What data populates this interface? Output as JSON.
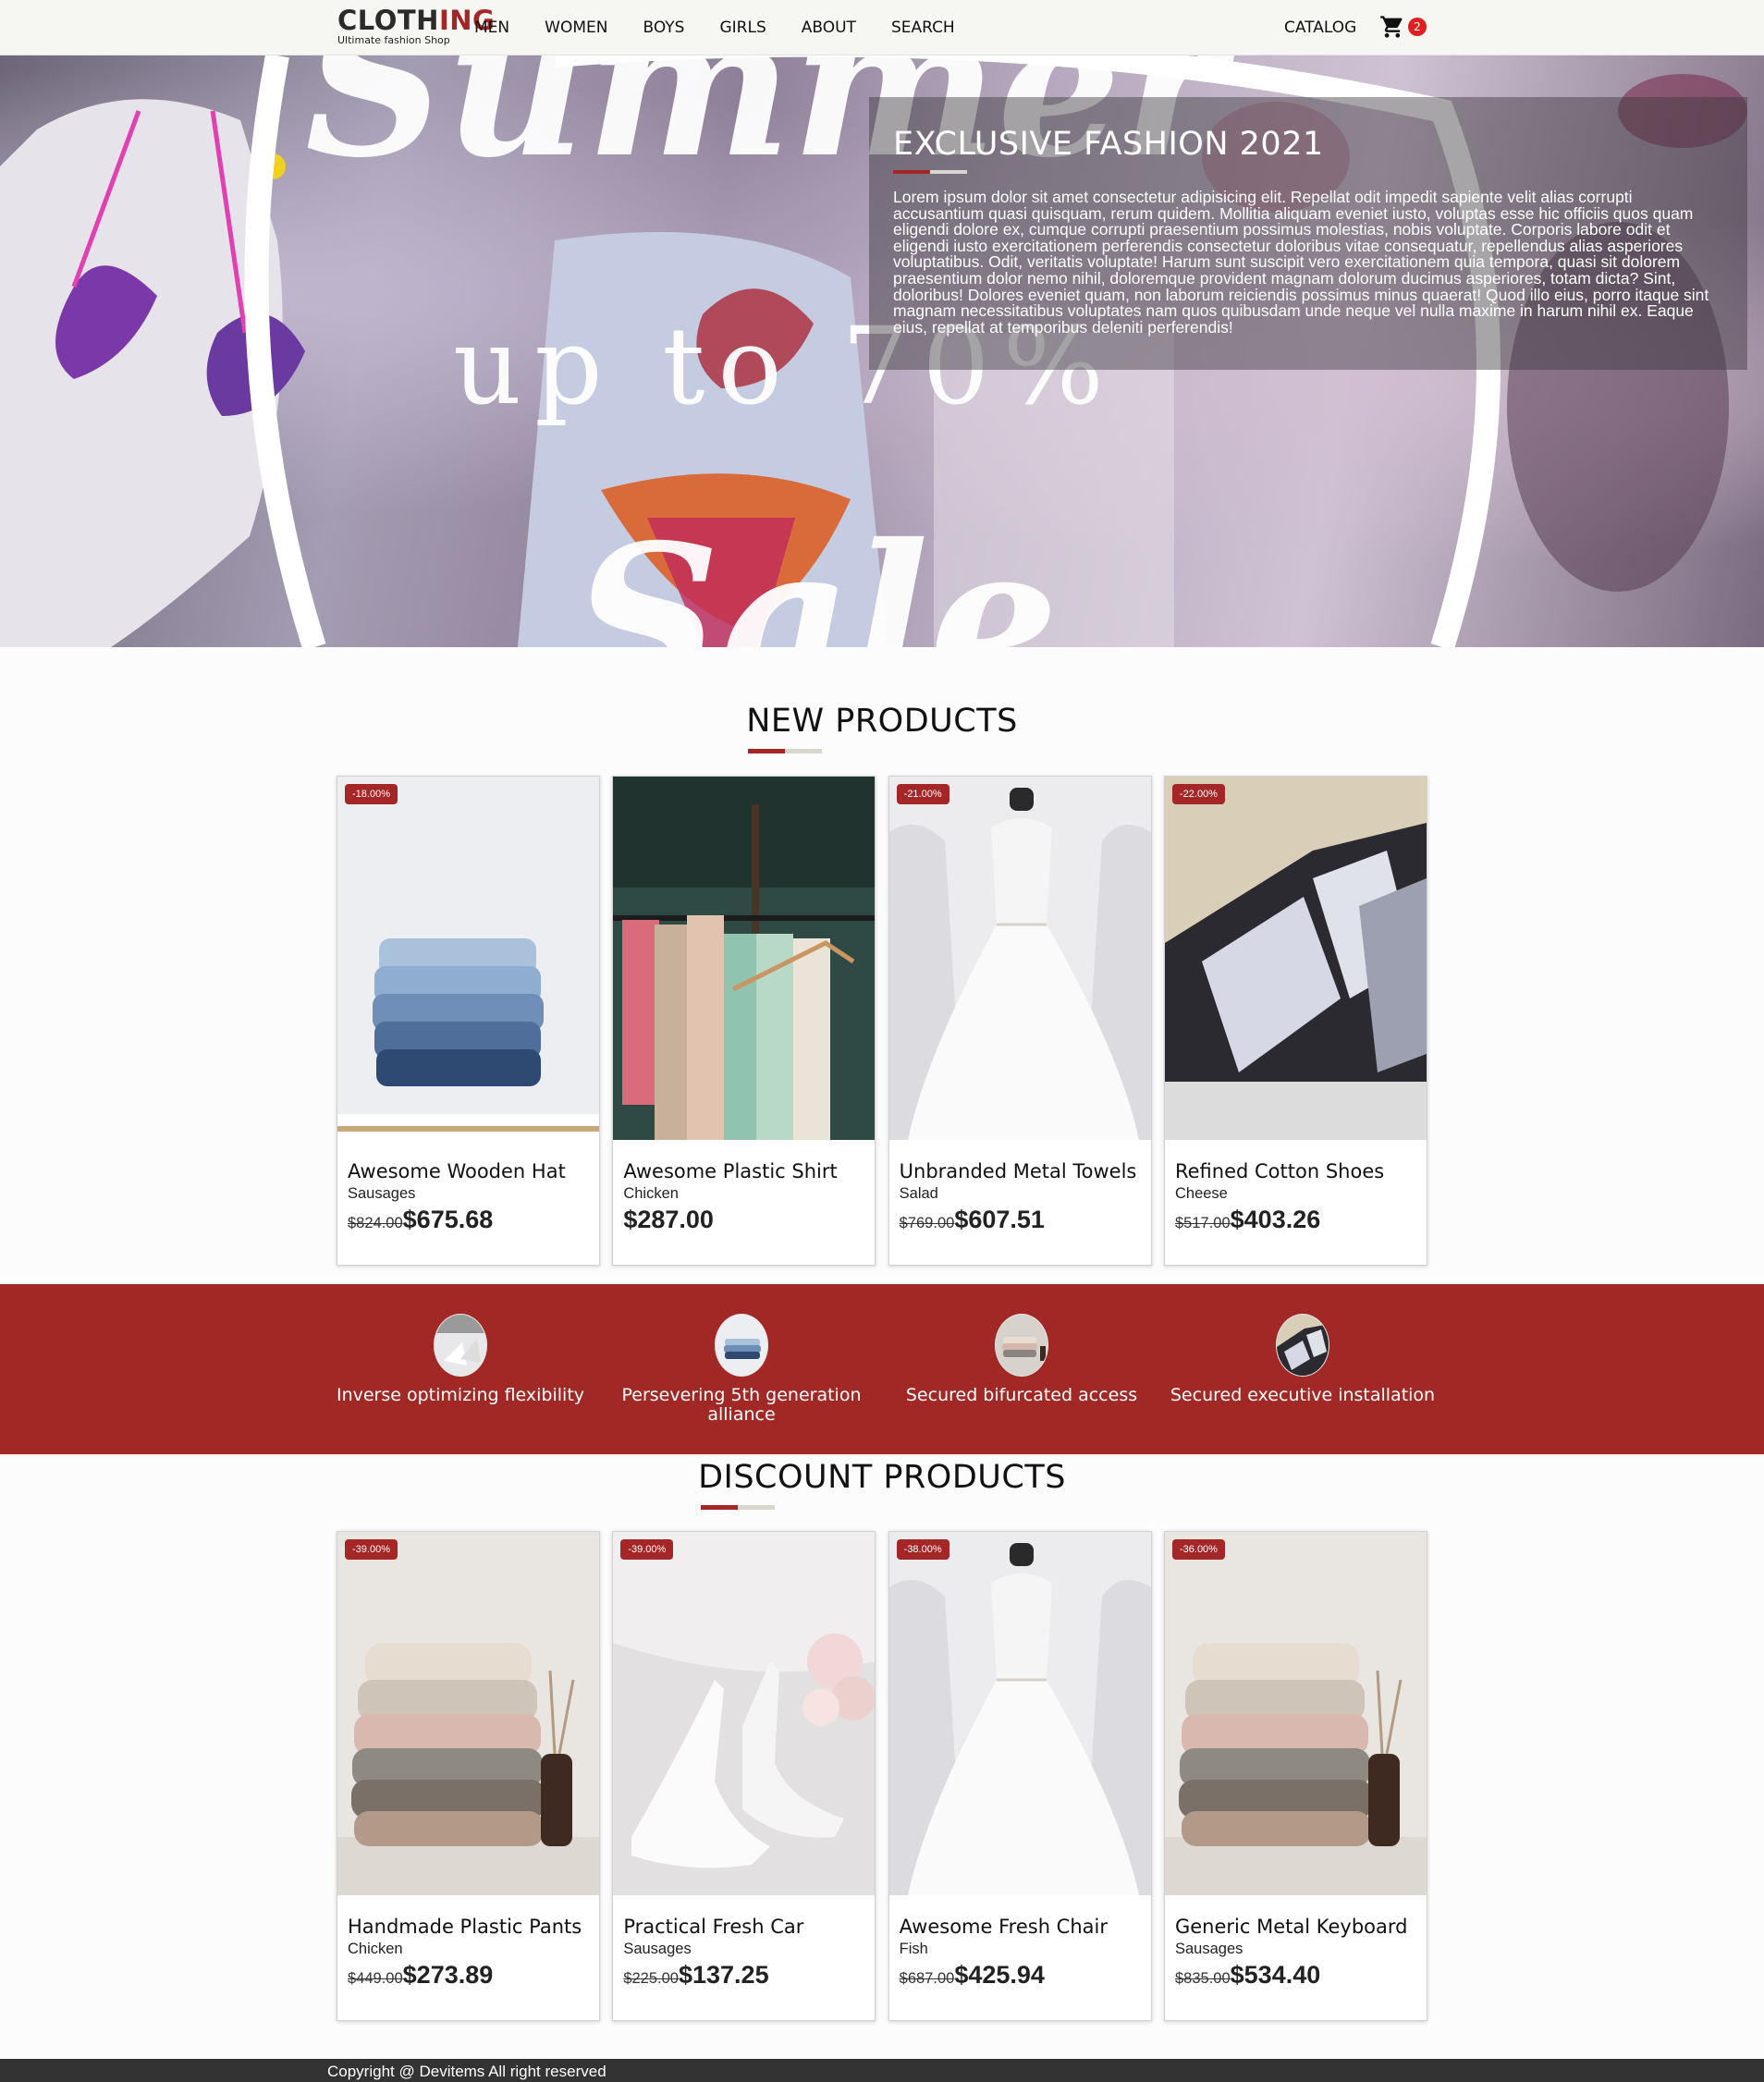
{
  "header": {
    "logo_main": "CLOTHING",
    "logo_dark": "CLOTH",
    "logo_red": "ING",
    "logo_tagline": "Ultimate fashion Shop",
    "nav": [
      "MEN",
      "WOMEN",
      "BOYS",
      "GIRLS",
      "ABOUT",
      "SEARCH"
    ],
    "catalog": "CATALOG",
    "cart_count": "2",
    "cart_icon": "shopping-cart-icon"
  },
  "hero": {
    "title": "EXCLUSIVE FASHION 2021",
    "text": "Lorem ipsum dolor sit amet consectetur adipisicing elit. Repellat odit impedit sapiente velit alias corrupti accusantium quasi quisquam, rerum quidem. Mollitia aliquam eveniet iusto, voluptas esse hic officiis quos quam eligendi dolore ex, cumque corrupti praesentium possimus molestias, nobis voluptate. Corporis labore odit et eligendi iusto exercitationem perferendis consectetur doloribus vitae consequatur, repellendus alias asperiores voluptatibus. Odit, veritatis voluptate! Harum sunt suscipit vero exercitationem quia tempora, quasi sit dolorem praesentium dolor nemo nihil, doloremque provident magnam dolorum ducimus asperiores, totam dicta? Sint, doloribus! Dolores eveniet quam, non laborum reiciendis possimus minus quaerat! Quod illo eius, porro itaque sint magnam necessitatibus voluptates nam quos quibusdam unde neque vel nulla maxime in harum nihil ex. Eaque eius, repellat at temporibus deleniti perferendis!",
    "image_text": {
      "word1": "Summer",
      "word2": "up  to  70%",
      "word3": "Sale"
    }
  },
  "new_products": {
    "title": "NEW PRODUCTS",
    "items": [
      {
        "name": "Awesome Wooden Hat",
        "category": "Sausages",
        "old_price": "$824.00",
        "price": "$675.68",
        "discount": "-18.00%"
      },
      {
        "name": "Awesome Plastic Shirt",
        "category": "Chicken",
        "old_price": "",
        "price": "$287.00",
        "discount": ""
      },
      {
        "name": "Unbranded Metal Towels",
        "category": "Salad",
        "old_price": "$769.00",
        "price": "$607.51",
        "discount": "-21.00%"
      },
      {
        "name": "Refined Cotton Shoes",
        "category": "Cheese",
        "old_price": "$517.00",
        "price": "$403.26",
        "discount": "-22.00%"
      }
    ]
  },
  "features": [
    {
      "label": "Inverse optimizing flexibility"
    },
    {
      "label": "Persevering 5th generation alliance"
    },
    {
      "label": "Secured bifurcated access"
    },
    {
      "label": "Secured executive installation"
    }
  ],
  "discount_products": {
    "title": "DISCOUNT PRODUCTS",
    "items": [
      {
        "name": "Handmade Plastic Pants",
        "category": "Chicken",
        "old_price": "$449.00",
        "price": "$273.89",
        "discount": "-39.00%"
      },
      {
        "name": "Practical Fresh Car",
        "category": "Sausages",
        "old_price": "$225.00",
        "price": "$137.25",
        "discount": "-39.00%"
      },
      {
        "name": "Awesome Fresh Chair",
        "category": "Fish",
        "old_price": "$687.00",
        "price": "$425.94",
        "discount": "-38.00%"
      },
      {
        "name": "Generic Metal Keyboard",
        "category": "Sausages",
        "old_price": "$835.00",
        "price": "$534.40",
        "discount": "-36.00%"
      }
    ]
  },
  "footer": {
    "text": "Copyright @ Devitems All right reserved"
  },
  "colors": {
    "accent": "#a22826",
    "header_bg": "#f6f6f2",
    "footer_bg": "#333333"
  }
}
